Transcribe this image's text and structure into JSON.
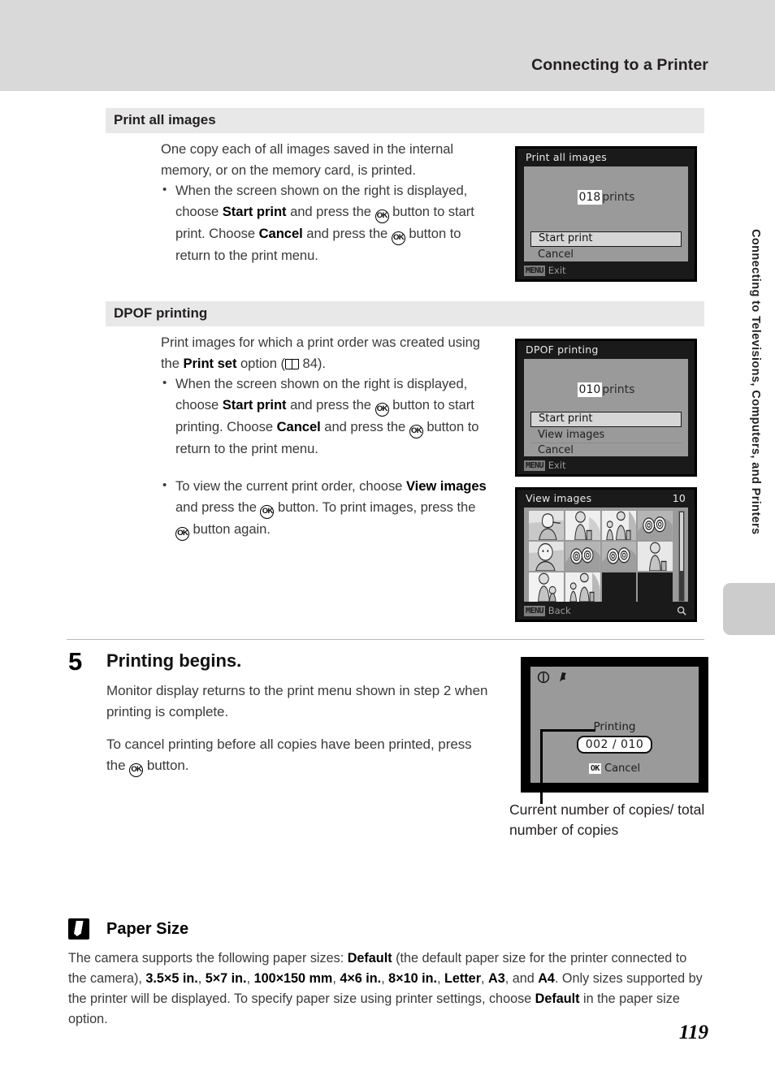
{
  "header": {
    "title": "Connecting to a Printer"
  },
  "side_tab": {
    "label": "Connecting to Televisions, Computers, and Printers"
  },
  "page_number": "119",
  "sections": [
    {
      "heading": "Print all images",
      "intro": "One copy each of all images saved in the internal memory, or on the memory card, is printed.",
      "bullets": [
        "When the screen shown on the right is displayed, choose <b>Start print</b> and press the <span class=\"okg\">OK</span> button to start print. Choose <b>Cancel</b> and press the <span class=\"okg\">OK</span> button to return to the print menu."
      ]
    },
    {
      "heading": "DPOF printing",
      "intro": "Print images for which a print order was created using the <b>Print set</b> option (<span class=\"bookg\"></span> 84).",
      "bullets": [
        "When the screen shown on the right is displayed, choose <b>Start print</b> and press the <span class=\"okg\">OK</span> button to start printing. Choose <b>Cancel</b> and press the <span class=\"okg\">OK</span> button to return to the print menu.",
        "To view the current print order, choose <b>View images</b> and press the <span class=\"okg\">OK</span> button. To print images, press the <span class=\"okg\">OK</span> button again."
      ]
    }
  ],
  "screens": {
    "print_all": {
      "title": "Print all images",
      "count_value": "018",
      "count_label": "prints",
      "items": [
        {
          "label": "Start print",
          "selected": true
        },
        {
          "label": "Cancel",
          "selected": false
        }
      ],
      "footer_key": "MENU",
      "footer_label": "Exit"
    },
    "dpof": {
      "title": "DPOF printing",
      "count_value": "010",
      "count_label": "prints",
      "items": [
        {
          "label": "Start print",
          "selected": true
        },
        {
          "label": "View images",
          "selected": false
        },
        {
          "label": "Cancel",
          "selected": false
        }
      ],
      "footer_key": "MENU",
      "footer_label": "Exit"
    },
    "view_images": {
      "title": "View images",
      "count": "10",
      "footer_key": "MENU",
      "footer_label": "Back",
      "thumbnails": [
        "portrait-woman",
        "person-standing",
        "adult-and-child",
        "flowers",
        "portrait-face",
        "flowers",
        "flowers",
        "person-standing",
        "person-with-child",
        "adult-and-child",
        "",
        ""
      ]
    },
    "printing": {
      "status_icons": [
        "battery-warning-icon",
        "flag-icon"
      ],
      "label": "Printing",
      "count": "002 / 010",
      "cancel_key": "OK",
      "cancel_label": "Cancel"
    }
  },
  "caption": "Current number of copies/ total number of copies",
  "step": {
    "number": "5",
    "title": "Printing begins.",
    "paragraphs": [
      "Monitor display returns to the print menu shown in step 2 when printing is complete.",
      "To cancel printing before all copies have been printed, press the <span class=\"okg\">OK</span> button."
    ]
  },
  "note": {
    "title": "Paper Size",
    "body": "The camera supports the following paper sizes: <b>Default</b> (the default paper size for the printer connected to the camera), <b>3.5&times;5 in.</b>, <b>5&times;7 in.</b>, <b>100&times;150 mm</b>, <b>4&times;6 in.</b>, <b>8&times;10 in.</b>, <b>Letter</b>, <b>A3</b>, and <b>A4</b>. Only sizes supported by the printer will be displayed. To specify paper size using printer settings, choose <b>Default</b> in the paper size option."
  },
  "colors": {
    "header_band": "#d9d9d9",
    "section_band": "#e8e8e8",
    "screen_bg": "#9a9a9a",
    "screen_frame": "#1a1a1a"
  }
}
